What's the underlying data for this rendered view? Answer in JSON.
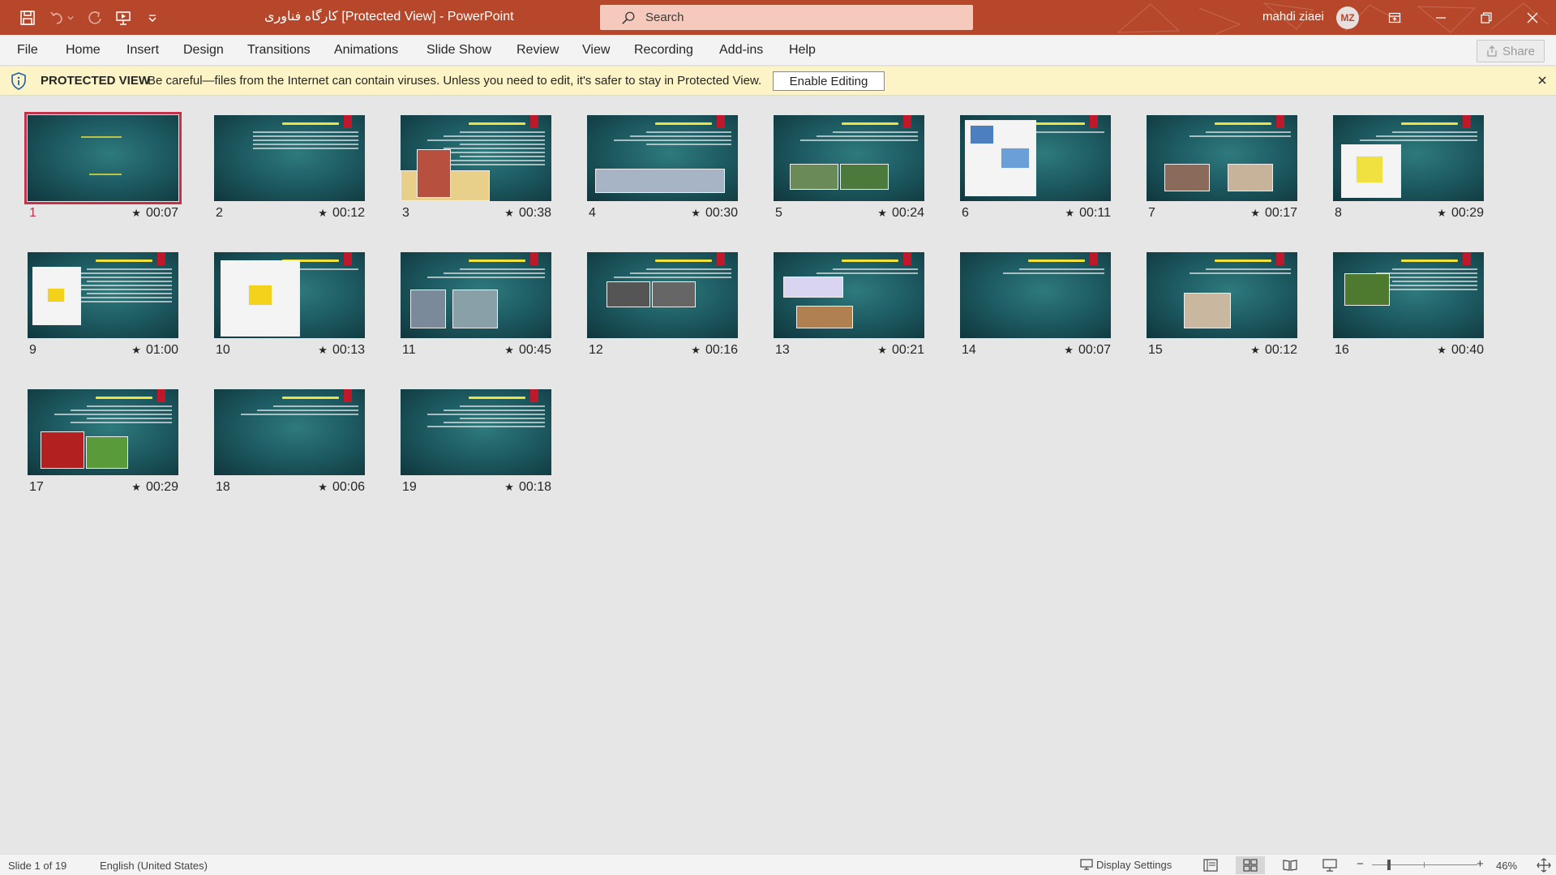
{
  "titlebar": {
    "doc_title": "کارگاه فناوری  [Protected View]  -  PowerPoint",
    "search_placeholder": "Search",
    "user_name": "mahdi ziaei",
    "user_initials": "MZ"
  },
  "menu": {
    "items": [
      "File",
      "Home",
      "Insert",
      "Design",
      "Transitions",
      "Animations",
      "Slide Show",
      "Review",
      "View",
      "Recording",
      "Add-ins",
      "Help"
    ],
    "share_label": "Share"
  },
  "protected_view": {
    "title": "PROTECTED VIEW",
    "message": "Be careful—files from the Internet can contain viruses. Unless you need to edit, it's safer to stay in Protected View.",
    "enable_label": "Enable Editing"
  },
  "slides": [
    {
      "number": "1",
      "timing": "00:07",
      "selected": true
    },
    {
      "number": "2",
      "timing": "00:12"
    },
    {
      "number": "3",
      "timing": "00:38"
    },
    {
      "number": "4",
      "timing": "00:30"
    },
    {
      "number": "5",
      "timing": "00:24"
    },
    {
      "number": "6",
      "timing": "00:11"
    },
    {
      "number": "7",
      "timing": "00:17"
    },
    {
      "number": "8",
      "timing": "00:29"
    },
    {
      "number": "9",
      "timing": "01:00"
    },
    {
      "number": "10",
      "timing": "00:13"
    },
    {
      "number": "11",
      "timing": "00:45"
    },
    {
      "number": "12",
      "timing": "00:16"
    },
    {
      "number": "13",
      "timing": "00:21"
    },
    {
      "number": "14",
      "timing": "00:07"
    },
    {
      "number": "15",
      "timing": "00:12"
    },
    {
      "number": "16",
      "timing": "00:40"
    },
    {
      "number": "17",
      "timing": "00:29"
    },
    {
      "number": "18",
      "timing": "00:06"
    },
    {
      "number": "19",
      "timing": "00:18"
    }
  ],
  "statusbar": {
    "slide_count": "Slide 1 of 19",
    "language": "English (United States)",
    "display_settings": "Display Settings",
    "zoom_level": "46%"
  },
  "colors": {
    "accent": "#b7472a",
    "selection": "#c4314b",
    "slide_bg": "#1e5c63"
  }
}
